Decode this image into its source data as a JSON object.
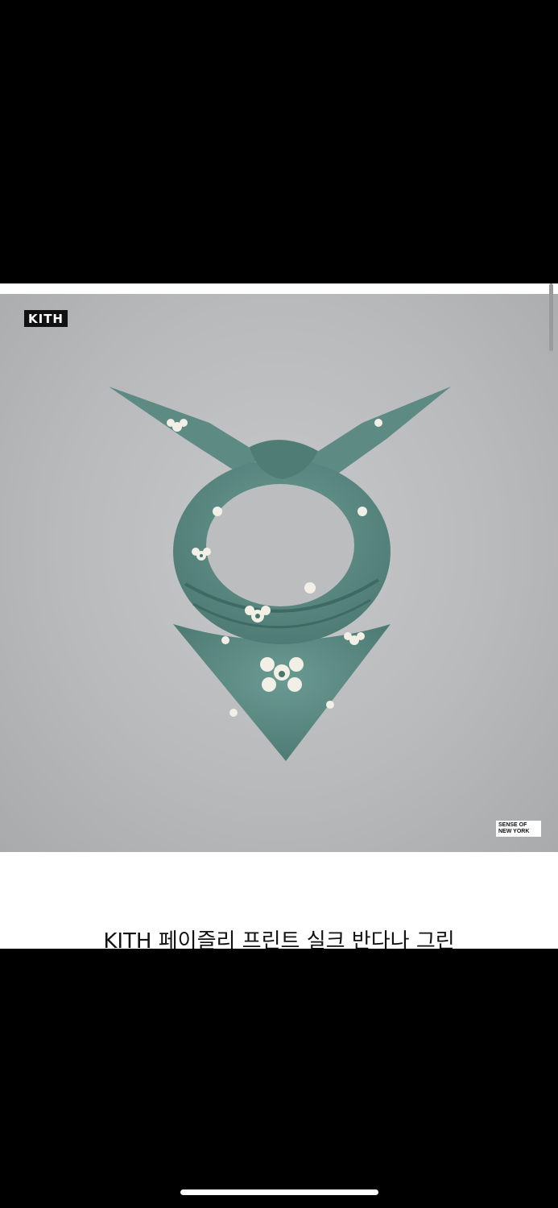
{
  "product": {
    "brand_logo": "KITH",
    "badge_text": "SENSE OF NEW YORK",
    "title": "KITH 페이즐리 프린트 실크 반다나 그린"
  },
  "colors": {
    "scarf_green": "#5f8d86",
    "pattern_white": "#f2efe6",
    "background_grey": "#bcbdbf"
  },
  "icons": [
    "scroll-indicator",
    "home-indicator"
  ]
}
